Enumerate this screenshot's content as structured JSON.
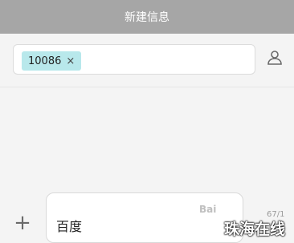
{
  "header": {
    "title": "新建信息"
  },
  "recipients": {
    "chips": [
      {
        "label": "10086",
        "remove_icon": "close-icon"
      }
    ],
    "contact_icon": "person-icon"
  },
  "composer": {
    "plus_label": "+",
    "message_text": "百度",
    "counter": "67/1"
  },
  "overlays": {
    "watermark": "Bai",
    "brand": "珠海在线"
  }
}
